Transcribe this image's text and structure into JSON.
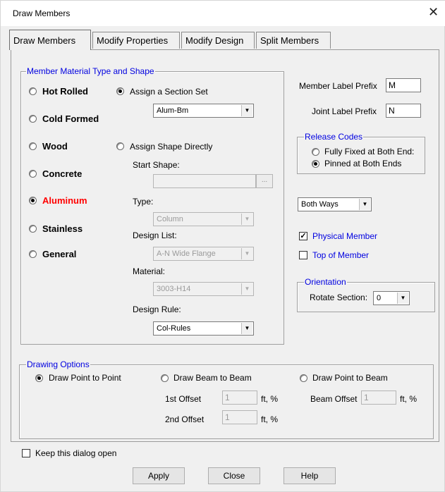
{
  "window": {
    "title": "Draw Members"
  },
  "tabs": [
    "Draw Members",
    "Modify Properties",
    "Modify Design",
    "Split Members"
  ],
  "material_group": {
    "legend": "Member Material Type and Shape",
    "materials": [
      "Hot Rolled",
      "Cold Formed",
      "Wood",
      "Concrete",
      "Aluminum",
      "Stainless",
      "General"
    ],
    "selected": "Aluminum",
    "assign_section_set_label": "Assign a Section Set",
    "section_set_value": "Alum-Bm",
    "assign_shape_directly_label": "Assign Shape Directly",
    "start_shape_label": "Start Shape:",
    "start_shape_value": "",
    "browse_label": "...",
    "type_label": "Type:",
    "type_value": "Column",
    "design_list_label": "Design List:",
    "design_list_value": "A-N Wide Flange",
    "material_label": "Material:",
    "material_value": "3003-H14",
    "design_rule_label": "Design Rule:",
    "design_rule_value": "Col-Rules"
  },
  "labels": {
    "member_prefix_label": "Member Label Prefix",
    "member_prefix_value": "M",
    "joint_prefix_label": "Joint Label Prefix",
    "joint_prefix_value": "N"
  },
  "release_codes": {
    "legend": "Release Codes",
    "fully_fixed": "Fully Fixed at Both End:",
    "pinned": "Pinned at Both Ends",
    "selected": "Pinned at Both Ends"
  },
  "direction_value": "Both Ways",
  "physical_member_label": "Physical Member",
  "physical_member_checked": true,
  "top_of_member_label": "Top of Member",
  "top_of_member_checked": false,
  "orientation": {
    "legend": "Orientation",
    "rotate_label": "Rotate Section:",
    "rotate_value": "0"
  },
  "drawing_options": {
    "legend": "Drawing Options",
    "point_to_point": "Draw Point to Point",
    "beam_to_beam": "Draw Beam to Beam",
    "point_to_beam": "Draw Point to Beam",
    "selected": "Draw Point to Point",
    "first_offset_label": "1st Offset",
    "first_offset_value": "1",
    "second_offset_label": "2nd Offset",
    "second_offset_value": "1",
    "beam_offset_label": "Beam Offset",
    "beam_offset_value": "1",
    "units": "ft, %"
  },
  "keep_open_label": "Keep this dialog open",
  "keep_open_checked": false,
  "buttons": {
    "apply": "Apply",
    "close": "Close",
    "help": "Help"
  },
  "colors": {
    "legend_blue": "#0000e0",
    "selected_red": "#ff0000",
    "dialog_bg": "#f0f0f0"
  }
}
